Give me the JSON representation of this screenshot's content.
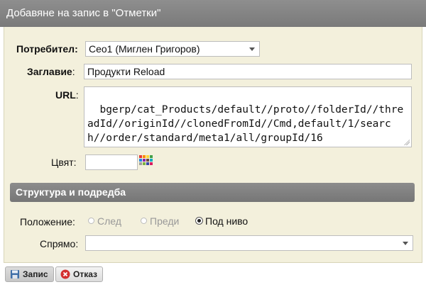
{
  "dialog": {
    "title": "Добавяне на запис в \"Отметки\""
  },
  "form": {
    "user_label": "Потребител",
    "user_value": "Ceo1 (Миглен Григоров)",
    "title_label": "Заглавие",
    "title_value": "Продукти Reload",
    "url_label": "URL",
    "url_value": "bgerp/cat_Products/default//proto//folderId//threadId//originId//clonedFromId//Cmd,default/1/search//order/standard/meta1/all/groupId/16",
    "color_label": "Цвят:",
    "color_value": ""
  },
  "structure": {
    "section_title": "Структура и подредба",
    "position_label": "Положение:",
    "position_options": [
      "След",
      "Преди",
      "Под ниво"
    ],
    "position_selected": "Под ниво",
    "relative_label": "Спрямо:",
    "relative_value": ""
  },
  "buttons": {
    "save_label": "Запис",
    "cancel_label": "Отказ"
  },
  "colors": {
    "title_bar": "#7f7f7f",
    "panel_bg": "#f3f0dc",
    "section_bar": "#808080"
  },
  "icons": {
    "palette": "color-palette-icon",
    "save": "floppy-disk-icon",
    "cancel": "cancel-icon"
  }
}
